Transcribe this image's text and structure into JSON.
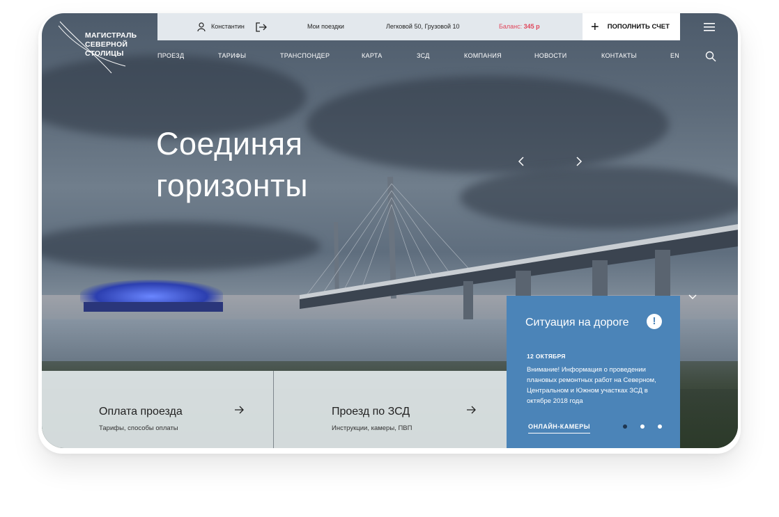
{
  "logo": {
    "line1": "МАГИСТРАЛЬ",
    "line2": "СЕВЕРНОЙ СТОЛИЦЫ"
  },
  "topbar": {
    "user_name": "Константин",
    "my_trips": "Мои поездки",
    "vehicles": "Легковой 50, Грузовой 10",
    "balance_label": "Баланс:",
    "balance_value": "345 р",
    "topup_label": "ПОПОЛНИТЬ СЧЕТ"
  },
  "nav": {
    "items": [
      "ПРОЕЗД",
      "ТАРИФЫ",
      "ТРАНСПОНДЕР",
      "КАРТА",
      "ЗСД",
      "КОМПАНИЯ",
      "НОВОСТИ",
      "КОНТАКТЫ",
      "EN"
    ]
  },
  "hero": {
    "line1": "Соединяя",
    "line2": "горизонты"
  },
  "cards": [
    {
      "title": "Оплата проезда",
      "subtitle": "Тарифы, способы оплаты"
    },
    {
      "title": "Проезд по ЗСД",
      "subtitle": "Инструкции, камеры, ПВП"
    }
  ],
  "road_situation": {
    "title": "Ситуация на дороге",
    "date": "12 ОКТЯБРЯ",
    "message": "Внимание! Информация о проведении плановых ремонтных работ на Северном, Центральном и Южном участках ЗСД в октябре 2018 года",
    "cameras_link": "ОНЛАЙН-КАМЕРЫ",
    "slides_total": 3,
    "slide_active": 1
  },
  "icons": {
    "user": "user-icon",
    "logout": "logout-icon",
    "plus": "plus-icon",
    "menu": "hamburger-menu-icon",
    "search": "search-icon",
    "prev": "chevron-left-icon",
    "next": "chevron-right-icon",
    "collapse": "chevron-down-icon",
    "alert": "exclamation-icon",
    "card_arrow": "arrow-right-icon"
  },
  "colors": {
    "accent_blue": "#4b84b8",
    "balance_red": "#e0465b",
    "topbar_bg": "#e3e8ed"
  }
}
